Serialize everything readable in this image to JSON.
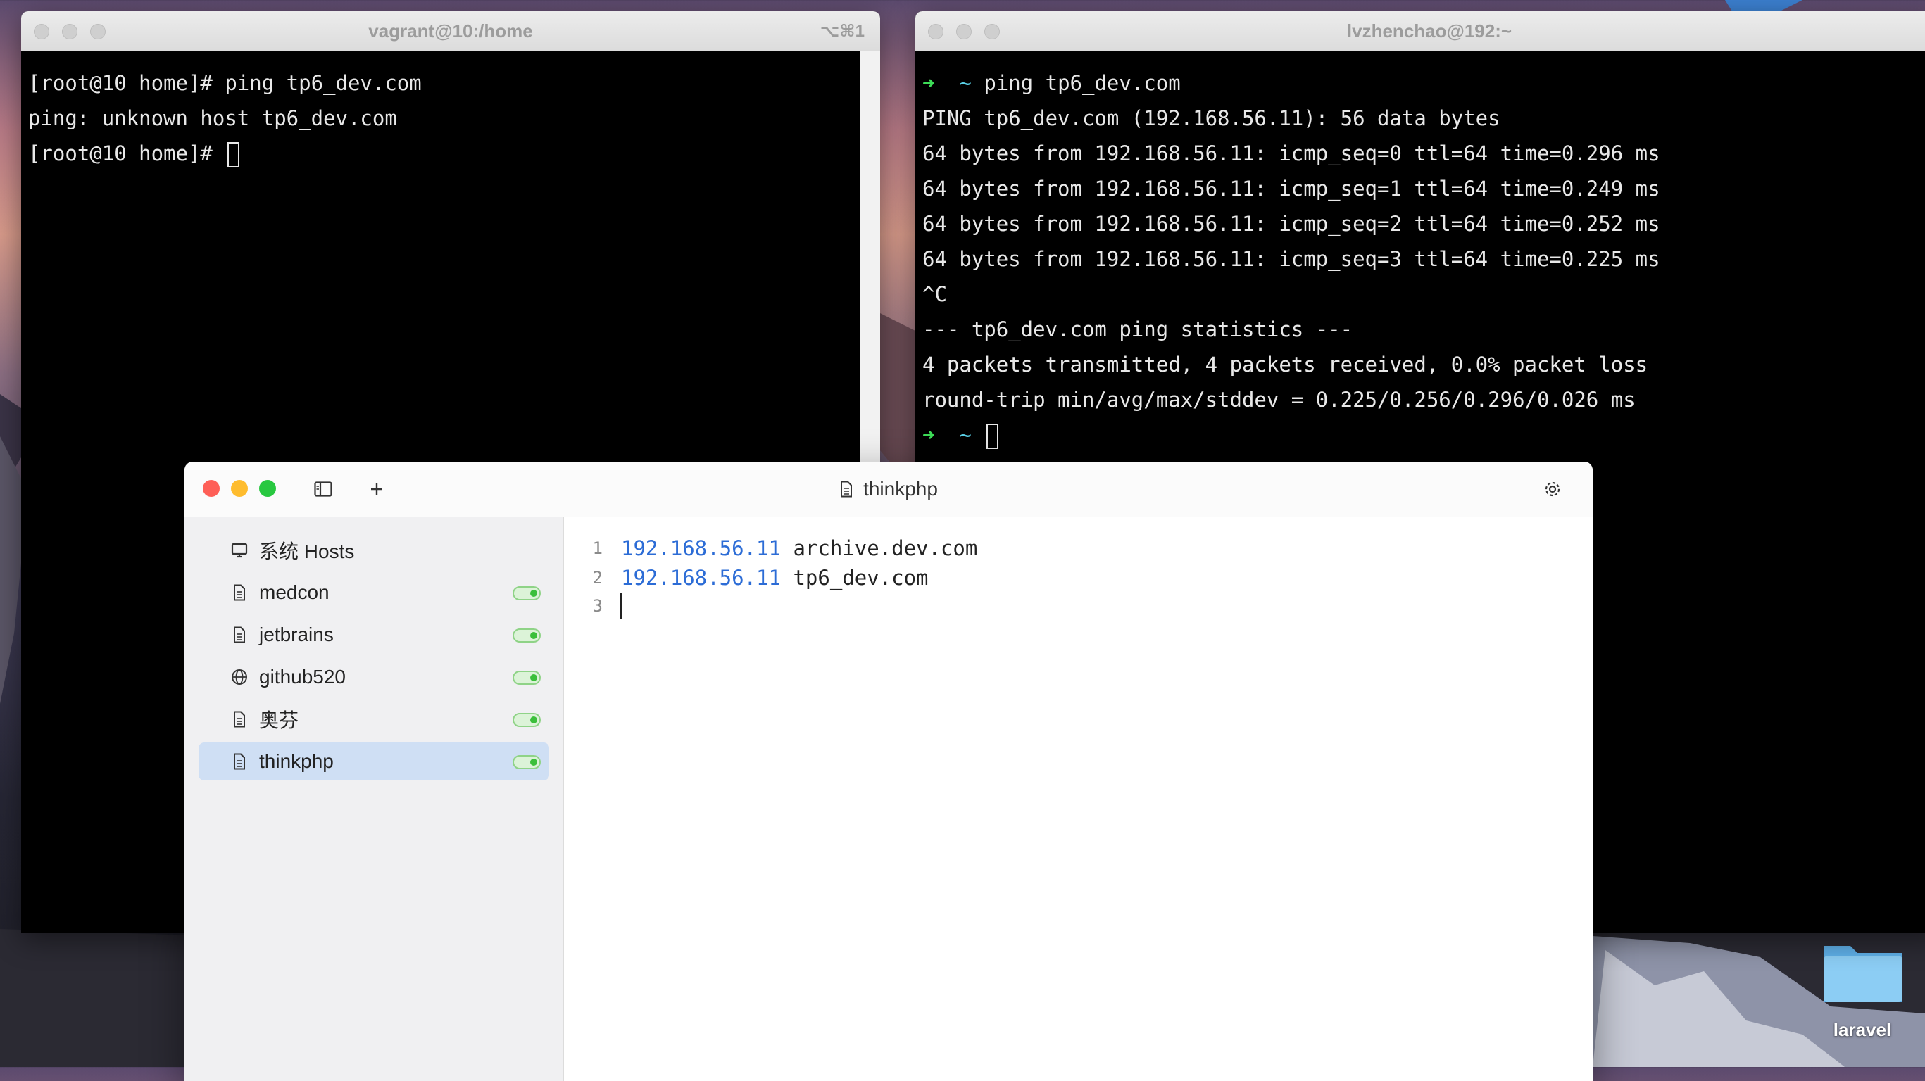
{
  "terminal_left": {
    "title": "vagrant@10:/home",
    "shortcut": "⌥⌘1",
    "lines": [
      "[root@10 home]# ping tp6_dev.com",
      "ping: unknown host tp6_dev.com",
      "[root@10 home]# "
    ]
  },
  "terminal_right": {
    "title": "lvzhenchao@192:~",
    "prompt_arrow": "➜",
    "prompt_dir": "~",
    "first_cmd": " ping tp6_dev.com",
    "lines": [
      "PING tp6_dev.com (192.168.56.11): 56 data bytes",
      "64 bytes from 192.168.56.11: icmp_seq=0 ttl=64 time=0.296 ms",
      "64 bytes from 192.168.56.11: icmp_seq=1 ttl=64 time=0.249 ms",
      "64 bytes from 192.168.56.11: icmp_seq=2 ttl=64 time=0.252 ms",
      "64 bytes from 192.168.56.11: icmp_seq=3 ttl=64 time=0.225 ms",
      "^C",
      "--- tp6_dev.com ping statistics ---",
      "4 packets transmitted, 4 packets received, 0.0% packet loss",
      "round-trip min/avg/max/stddev = 0.225/0.256/0.296/0.026 ms"
    ]
  },
  "hosts_app": {
    "title": "thinkphp",
    "sidebar": [
      {
        "label": "系统 Hosts",
        "icon": "monitor-icon",
        "toggle": false,
        "active": false
      },
      {
        "label": "medcon",
        "icon": "document-icon",
        "toggle": true,
        "active": false
      },
      {
        "label": "jetbrains",
        "icon": "document-icon",
        "toggle": true,
        "active": false
      },
      {
        "label": "github520",
        "icon": "globe-icon",
        "toggle": true,
        "active": false
      },
      {
        "label": "奥芬",
        "icon": "document-icon",
        "toggle": true,
        "active": false
      },
      {
        "label": "thinkphp",
        "icon": "document-icon",
        "toggle": true,
        "active": true
      }
    ],
    "editor": {
      "lines": [
        {
          "num": "1",
          "ip": "192.168.56.11",
          "host": " archive.dev.com"
        },
        {
          "num": "2",
          "ip": "192.168.56.11",
          "host": " tp6_dev.com"
        },
        {
          "num": "3",
          "ip": "",
          "host": ""
        }
      ]
    }
  },
  "desktop": {
    "folder_label": "laravel"
  }
}
